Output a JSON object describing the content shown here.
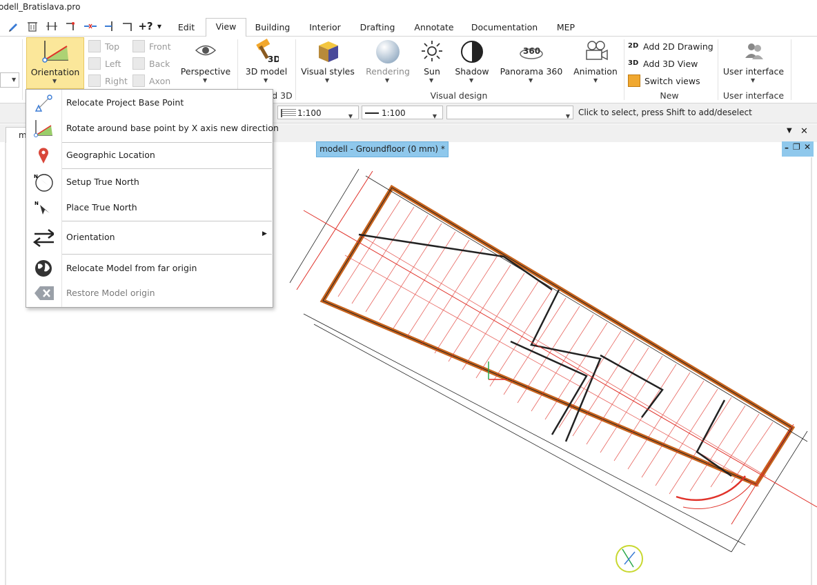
{
  "window": {
    "title": "odell_Bratislava.pro"
  },
  "tabs": [
    "Edit",
    "View",
    "Building",
    "Interior",
    "Drafting",
    "Annotate",
    "Documentation",
    "MEP"
  ],
  "active_tab": "View",
  "ribbon": {
    "orientation_label": "Orientation",
    "views": {
      "top": "Top",
      "left": "Left",
      "right": "Right",
      "front": "Front",
      "back": "Back",
      "axon": "Axon"
    },
    "perspective_label": "Perspective",
    "model3d_label": "3D model",
    "group_3d_partial": "d 3D",
    "visual_styles_label": "Visual styles",
    "rendering_label": "Rendering",
    "sun_label": "Sun",
    "shadow_label": "Shadow",
    "panorama_label": "Panorama 360",
    "panorama_badge": "360",
    "animation_label": "Animation",
    "group_visual_design": "Visual design",
    "add_2d_label": "Add 2D Drawing",
    "add_3d_label": "Add 3D View",
    "switch_views_label": "Switch views",
    "group_new": "New",
    "user_interface_label": "User interface",
    "group_user_interface": "User interface",
    "icon_2d": "2D",
    "icon_3d": "3D"
  },
  "toolbar": {
    "scale1": "1:100",
    "scale2": "1:100",
    "layer_value": "",
    "status_text": "Click to select, press Shift to add/deselect"
  },
  "document": {
    "tab_partial": "m",
    "view_tab": "modell - Groundfloor (0 mm) *"
  },
  "menu": {
    "items": [
      {
        "label": "Relocate Project Base Point",
        "icon": "base-point-icon",
        "enabled": true
      },
      {
        "label": "Rotate around base point by X axis new direction",
        "icon": "rotate-axis-icon",
        "enabled": true
      },
      {
        "label": "Geographic Location",
        "icon": "location-pin-icon",
        "enabled": true
      },
      {
        "label": "Setup True North",
        "icon": "compass-north-icon",
        "enabled": true
      },
      {
        "label": "Place True North",
        "icon": "north-arrow-icon",
        "enabled": true
      },
      {
        "label": "Orientation",
        "icon": "swap-arrows-icon",
        "enabled": true,
        "submenu": true
      },
      {
        "label": "Relocate Model from far origin",
        "icon": "globe-icon",
        "enabled": true
      },
      {
        "label": "Restore Model origin",
        "icon": "clear-icon",
        "enabled": false
      }
    ],
    "north_glyph": "N"
  },
  "colors": {
    "accent_highlight": "#fbe79a",
    "view_tab_bg": "#8fc8ec",
    "wall": "#c8641e",
    "redline": "#e0322a"
  }
}
